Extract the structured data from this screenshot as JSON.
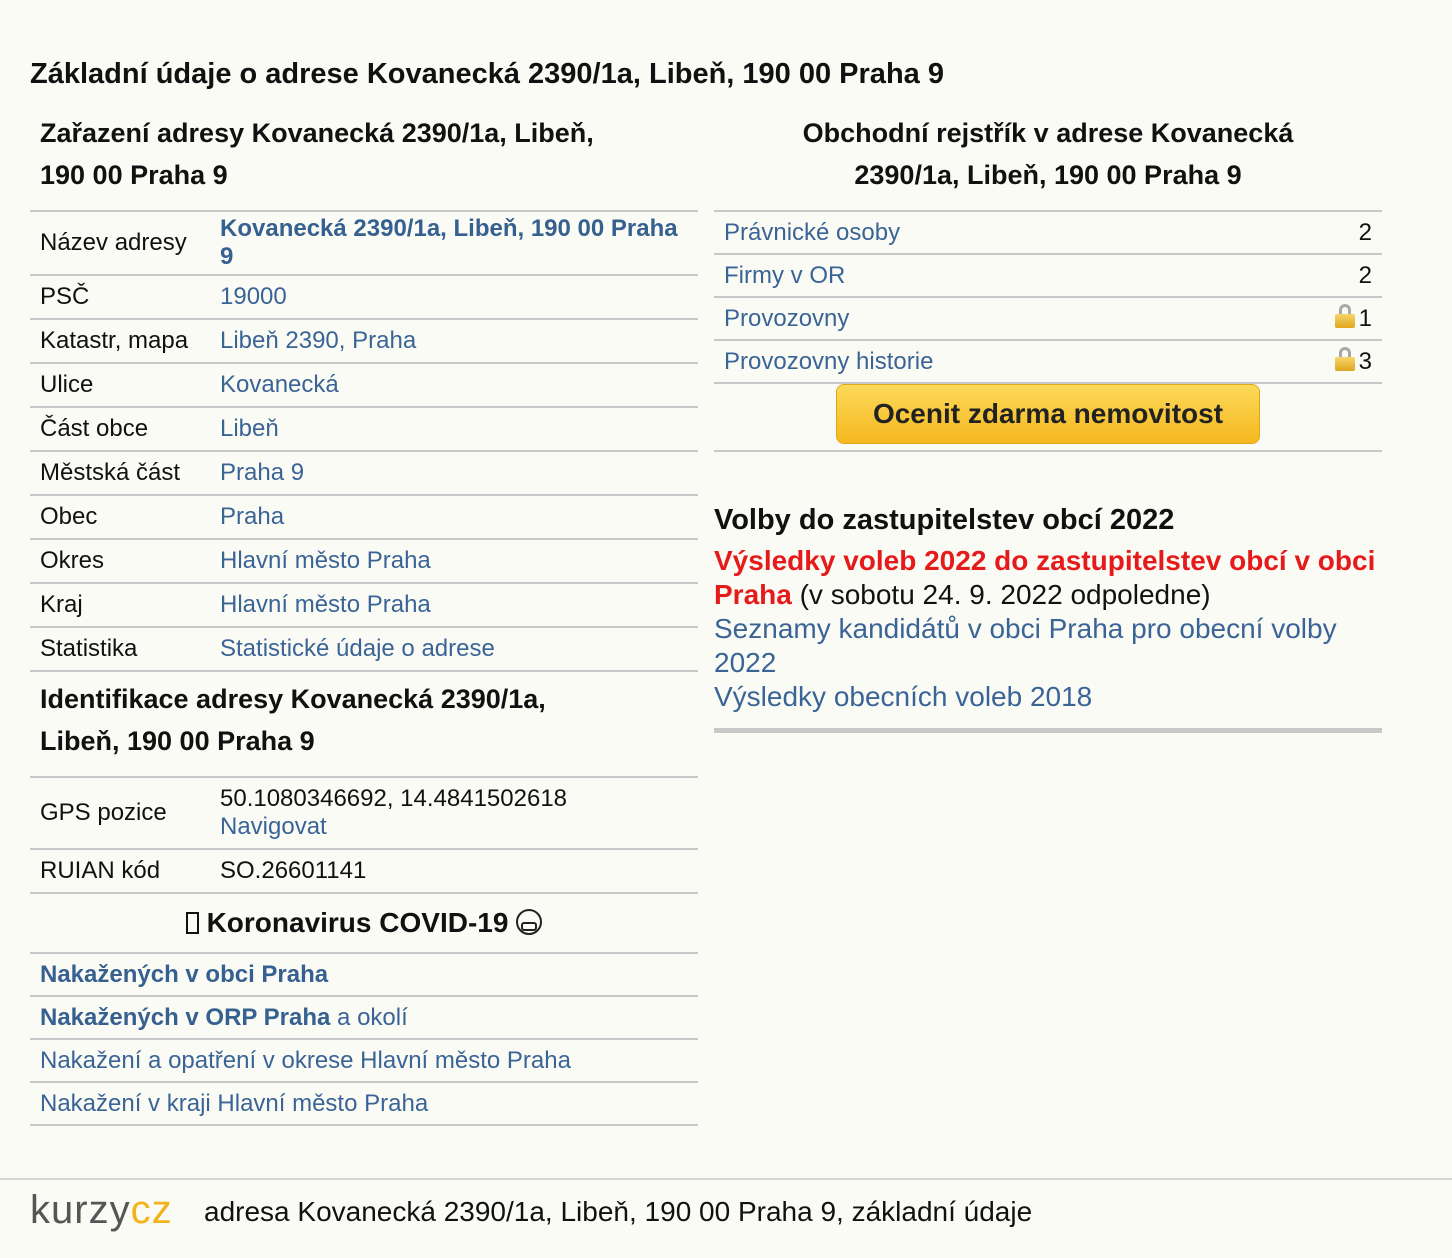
{
  "page_title": "Základní údaje o adrese Kovanecká 2390/1a, Libeň, 190 00 Praha 9",
  "zarazeni": {
    "heading_l1": "Zařazení adresy Kovanecká 2390/1a, Libeň,",
    "heading_l2": "190 00 Praha 9",
    "rows": [
      {
        "label": "Název adresy",
        "value": "Kovanecká 2390/1a, Libeň, 190 00 Praha 9"
      },
      {
        "label": "PSČ",
        "value": "19000"
      },
      {
        "label": "Katastr, mapa",
        "value": "Libeň 2390, Praha"
      },
      {
        "label": "Ulice",
        "value": "Kovanecká"
      },
      {
        "label": "Část obce",
        "value": "Libeň"
      },
      {
        "label": "Městská část",
        "value": "Praha 9"
      },
      {
        "label": "Obec",
        "value": "Praha"
      },
      {
        "label": "Okres",
        "value": "Hlavní město Praha"
      },
      {
        "label": "Kraj",
        "value": "Hlavní město Praha"
      },
      {
        "label": "Statistika",
        "value": "Statistické údaje o adrese"
      }
    ]
  },
  "identifikace": {
    "heading_l1": "Identifikace adresy Kovanecká 2390/1a,",
    "heading_l2": "Libeň, 190 00 Praha 9",
    "gps_label": "GPS pozice",
    "gps_value": "50.1080346692, 14.4841502618",
    "navigate_label": "Navigovat",
    "ruian_label": "RUIAN kód",
    "ruian_value": "SO.26601141"
  },
  "covid": {
    "title": "Koronavirus COVID-19",
    "link1": "Nakažených v obci Praha",
    "link2": "Nakažených v ORP Praha",
    "link2_suffix": "a okolí",
    "link3": "Nakažení a opatření v okrese Hlavní město Praha",
    "link4": "Nakažení v kraji Hlavní město Praha"
  },
  "rejstrik": {
    "heading_l1": "Obchodní rejstřík v adrese Kovanecká",
    "heading_l2": "2390/1a, Libeň, 190 00 Praha 9",
    "rows": [
      {
        "label": "Právnické osoby",
        "count": "2"
      },
      {
        "label": "Firmy v OR",
        "count": "2"
      },
      {
        "label": "Provozovny",
        "count": "1"
      },
      {
        "label": "Provozovny historie",
        "count": "3"
      }
    ],
    "button_label": "Ocenit zdarma nemovitost"
  },
  "volby": {
    "heading": "Volby do zastupitelstev obcí 2022",
    "results_link": "Výsledky voleb 2022 do zastupitelstev obcí v obci Praha",
    "results_note": "(v sobotu 24. 9. 2022 odpoledne)",
    "candidates_link": "Seznamy kandidátů v obci Praha pro obecní volby 2022",
    "results_2018_link": "Výsledky obecních voleb 2018"
  },
  "footer": {
    "logo_part1": "kurzy",
    "logo_part2": "cz",
    "text": "adresa Kovanecká 2390/1a, Libeň, 190 00 Praha 9, základní údaje"
  }
}
